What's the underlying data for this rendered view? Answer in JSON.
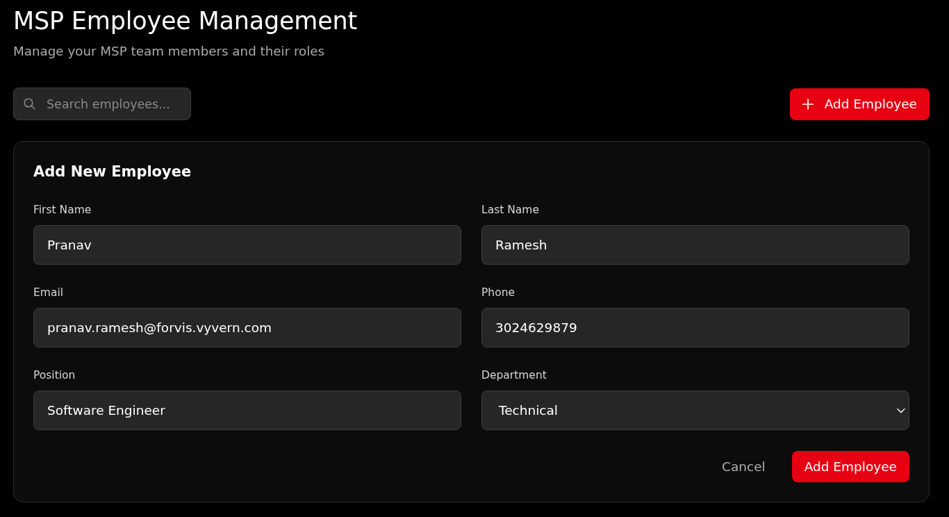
{
  "header": {
    "title": "MSP Employee Management",
    "subtitle": "Manage your MSP team members and their roles"
  },
  "toolbar": {
    "search": {
      "placeholder": "Search employees..."
    },
    "add_button": {
      "label": "Add Employee"
    }
  },
  "form": {
    "title": "Add New Employee",
    "fields": [
      {
        "kind": "text",
        "label": "First Name",
        "value": "Pranav"
      },
      {
        "kind": "text",
        "label": "Last Name",
        "value": "Ramesh"
      },
      {
        "kind": "text",
        "label": "Email",
        "value": "pranav.ramesh@forvis.vyvern.com"
      },
      {
        "kind": "text",
        "label": "Phone",
        "value": "3024629879"
      },
      {
        "kind": "text",
        "label": "Position",
        "value": "Software Engineer"
      },
      {
        "kind": "select",
        "label": "Department",
        "value": "Technical"
      }
    ],
    "actions": [
      {
        "kind": "link",
        "label": "Cancel"
      },
      {
        "kind": "primary",
        "label": "Add Employee"
      }
    ]
  }
}
